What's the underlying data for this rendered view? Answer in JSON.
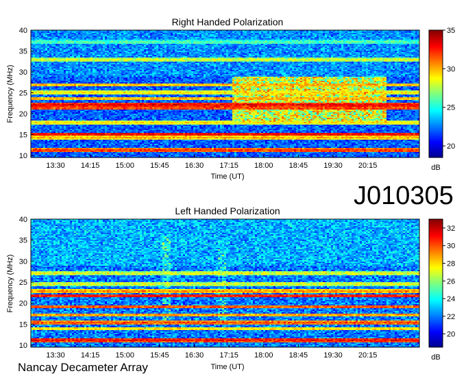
{
  "identifier": "J010305",
  "credit": "Nancay Decameter Array",
  "chart_data": [
    {
      "type": "heatmap",
      "title": "Right Handed Polarization",
      "xlabel": "Time (UT)",
      "ylabel": "Frequency (MHz)",
      "xticks": [
        "13:30",
        "14:15",
        "15:00",
        "15:45",
        "16:30",
        "17:15",
        "18:00",
        "18:45",
        "19:30",
        "20:15"
      ],
      "xlim": [
        "12:58",
        "21:22"
      ],
      "ylim": [
        9.5,
        40
      ],
      "yticks": [
        10,
        15,
        20,
        25,
        30,
        35,
        40
      ],
      "colorbar": {
        "label": "dB",
        "ticks": [
          20,
          25,
          30,
          35
        ],
        "range": [
          18.5,
          35
        ]
      },
      "bands": [
        {
          "freq": 11.2,
          "level": 33
        },
        {
          "freq": 14.3,
          "level": 31
        },
        {
          "freq": 15.1,
          "level": 34
        },
        {
          "freq": 17.8,
          "level": 30
        },
        {
          "freq": 21.3,
          "level": 33
        },
        {
          "freq": 22.1,
          "level": 34
        },
        {
          "freq": 23.6,
          "level": 31
        },
        {
          "freq": 25.0,
          "level": 30
        },
        {
          "freq": 26.9,
          "level": 31
        },
        {
          "freq": 32.9,
          "level": 29
        },
        {
          "freq": 37.1,
          "level": 27
        }
      ],
      "bursts": [
        {
          "t_start": "17:20",
          "t_end": "20:40",
          "f_low": 18,
          "f_high": 29,
          "level": 31
        }
      ]
    },
    {
      "type": "heatmap",
      "title": "Left Handed Polarization",
      "xlabel": "Time (UT)",
      "ylabel": "Frequency (MHz)",
      "xticks": [
        "13:30",
        "14:15",
        "15:00",
        "15:45",
        "16:30",
        "17:15",
        "18:00",
        "18:45",
        "19:30",
        "20:15"
      ],
      "xlim": [
        "12:58",
        "21:22"
      ],
      "ylim": [
        9.5,
        40
      ],
      "yticks": [
        10,
        15,
        20,
        25,
        30,
        35,
        40
      ],
      "colorbar": {
        "label": "dB",
        "ticks": [
          20,
          22,
          24,
          26,
          28,
          30,
          32
        ],
        "range": [
          18.5,
          33
        ]
      },
      "bands": [
        {
          "freq": 11.2,
          "level": 32
        },
        {
          "freq": 13.9,
          "level": 29
        },
        {
          "freq": 15.3,
          "level": 31
        },
        {
          "freq": 17.2,
          "level": 30
        },
        {
          "freq": 19.1,
          "level": 31
        },
        {
          "freq": 21.7,
          "level": 32
        },
        {
          "freq": 22.8,
          "level": 30
        },
        {
          "freq": 24.6,
          "level": 28
        },
        {
          "freq": 27.1,
          "level": 28
        }
      ],
      "bursts": [
        {
          "t_start": "15:50",
          "t_end": "16:00",
          "f_low": 15,
          "f_high": 36,
          "level": 26
        },
        {
          "t_start": "17:00",
          "t_end": "17:10",
          "f_low": 15,
          "f_high": 35,
          "level": 26
        }
      ]
    }
  ]
}
